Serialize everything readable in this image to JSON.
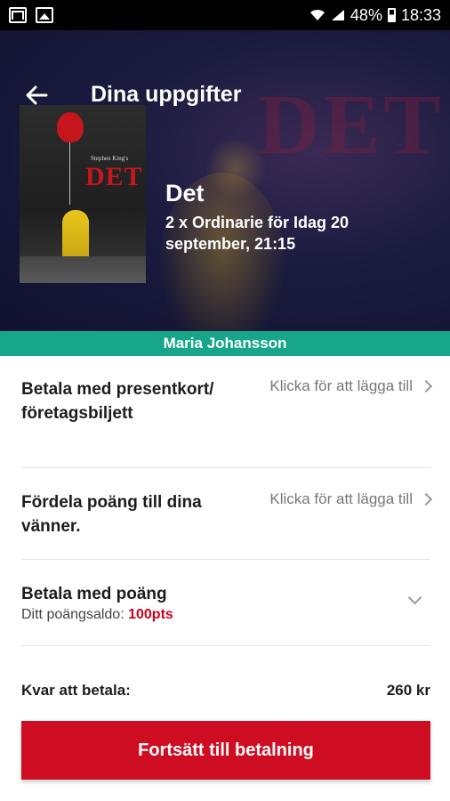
{
  "status_bar": {
    "battery": "48%",
    "time": "18:33"
  },
  "header": {
    "title": "Dina uppgifter"
  },
  "poster": {
    "title": "DET",
    "tagline": "Stephen King's"
  },
  "movie": {
    "title": "Det",
    "info": "2 x Ordinarie för Idag 20 september, 21:15"
  },
  "user": {
    "name": "Maria Johansson"
  },
  "options": {
    "gift_card": {
      "label": "Betala med presentkort/ företagsbiljett",
      "action": "Klicka för att lägga till"
    },
    "share_points": {
      "label": "Fördela poäng till dina vänner.",
      "action": "Klicka för att lägga till"
    },
    "pay_points": {
      "label": "Betala med poäng",
      "balance_label": "Ditt poängsaldo:",
      "balance_value": "100pts"
    }
  },
  "summary": {
    "label": "Kvar att betala:",
    "amount": "260 kr"
  },
  "cta": {
    "label": "Fortsätt till betalning"
  },
  "colors": {
    "accent_green": "#17a689",
    "cta_red": "#cf0d22",
    "points_red": "#d0021b"
  },
  "icons": [
    "mail-icon",
    "image-icon",
    "wifi-icon",
    "signal-icon",
    "battery-icon",
    "back-arrow-icon",
    "chevron-right-icon",
    "chevron-down-icon"
  ]
}
